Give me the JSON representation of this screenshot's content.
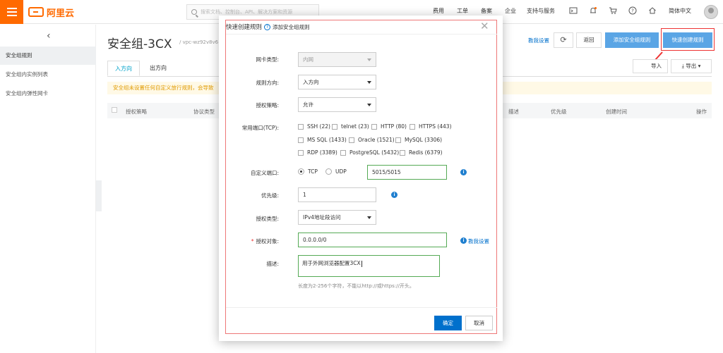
{
  "brand": {
    "logo_text": "阿里云",
    "accent": "#ff6a00"
  },
  "top": {
    "search_placeholder": "搜索文档、控制台、API、解决方案和资源",
    "nav": [
      "费用",
      "工单",
      "备案",
      "企业",
      "支持与服务"
    ],
    "language": "简体中文",
    "icons": [
      "terminal-icon",
      "bell-icon",
      "cart-icon",
      "help-icon",
      "home-icon"
    ]
  },
  "sidebar": {
    "items": [
      {
        "label": "安全组规则",
        "active": true
      },
      {
        "label": "安全组内实例列表",
        "active": false
      },
      {
        "label": "安全组内弹性网卡",
        "active": false
      }
    ]
  },
  "main": {
    "title": "安全组-3CX",
    "vpc": "/ vpc-wz92v8v6",
    "teach_link": "教我设置",
    "back_label": "返回",
    "add_rule_label": "添加安全组规则",
    "quick_rule_label": "快速创建规则",
    "import_label": "导入",
    "export_label": "导出",
    "tabs": [
      "入方向",
      "出方向"
    ],
    "notice": "安全组未设置任何自定义放行规则，会导致",
    "columns_left": [
      "授权策略",
      "协议类型"
    ],
    "columns_right": [
      "描述",
      "优先级",
      "创建时间",
      "操作"
    ]
  },
  "modal": {
    "title": "快速创建规则",
    "subtitle": "添加安全组规则",
    "fields": {
      "nic_type": {
        "label": "网卡类型:",
        "value": "内网"
      },
      "direction": {
        "label": "规则方向:",
        "value": "入方向"
      },
      "policy": {
        "label": "授权策略:",
        "value": "允许"
      },
      "common_ports": {
        "label": "常用端口(TCP):",
        "options": [
          "SSH (22)",
          "telnet (23)",
          "HTTP (80)",
          "HTTPS (443)",
          "MS SQL (1433)",
          "Oracle (1521)",
          "MySQL (3306)",
          "RDP (3389)",
          "PostgreSQL (5432)",
          "Redis (6379)"
        ]
      },
      "custom_port": {
        "label": "自定义端口:",
        "tcp": "TCP",
        "udp": "UDP",
        "selected": "TCP",
        "value": "5015/5015"
      },
      "priority": {
        "label": "优先级:",
        "value": "1"
      },
      "auth_type": {
        "label": "授权类型:",
        "value": "IPv4地址段访问"
      },
      "auth_object": {
        "label": "授权对象:",
        "value": "0.0.0.0/0",
        "teach": "教我设置"
      },
      "description": {
        "label": "描述:",
        "value": "用于外网浏览器配置3CX",
        "hint": "长度为2-256个字符，不能以http://或https://开头。"
      }
    },
    "ok_label": "确定",
    "cancel_label": "取消"
  }
}
